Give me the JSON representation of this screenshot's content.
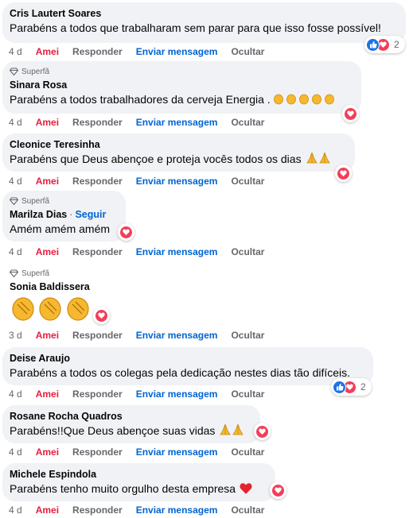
{
  "actions": {
    "amei": "Amei",
    "reply": "Responder",
    "message": "Enviar mensagem",
    "hide": "Ocultar"
  },
  "badge_label": "Superfã",
  "follow_label": "Seguir",
  "colors": {
    "love": "#f33e58",
    "like": "#1b74e4",
    "amei": "#e41e3f",
    "link": "#0064d1",
    "bubble": "#f0f2f5"
  },
  "comments": [
    {
      "name": "Cris Lautert Soares",
      "text": "Parabéns a todos que trabalharam sem parar para que isso fosse possível!",
      "time": "4 d",
      "reactions": [
        "like-icon",
        "heart-icon"
      ],
      "count": "2"
    },
    {
      "name": "Sinara Rosa",
      "superfan": true,
      "text": "Parabéns a todos trabalhadores da cerveja Energia .",
      "emoji": [
        "clap-emoji",
        "clap-emoji",
        "clap-emoji",
        "clap-emoji",
        "clap-emoji"
      ],
      "time": "4 d",
      "reactions": [
        "heart-icon"
      ]
    },
    {
      "name": "Cleonice Teresinha",
      "text": "Parabéns que Deus abençoe e proteja vocês todos os dias",
      "emoji": [
        "pray-emoji",
        "pray-emoji"
      ],
      "time": "4 d",
      "reactions": [
        "heart-icon"
      ]
    },
    {
      "name": "Marilza Dias",
      "superfan": true,
      "follow": true,
      "text": "Amém amém amém",
      "time": "4 d",
      "reactions": [
        "heart-icon"
      ]
    },
    {
      "name": "Sonia Baldissera",
      "superfan": true,
      "big_emoji": [
        "clap-emoji",
        "clap-emoji",
        "clap-emoji"
      ],
      "time": "3 d",
      "reactions": [
        "heart-icon"
      ]
    },
    {
      "name": "Deise Araujo",
      "text": "Parabéns a todos os colegas pela dedicação nestes dias tão difíceis.",
      "time": "4 d",
      "reactions": [
        "like-icon",
        "heart-icon"
      ],
      "count": "2"
    },
    {
      "name": "Rosane Rocha Quadros",
      "text": "Parabéns!!Que Deus abençoe suas vidas",
      "emoji": [
        "pray-emoji",
        "pray-emoji"
      ],
      "time": "4 d",
      "reactions": [
        "heart-icon"
      ]
    },
    {
      "name": "Michele Espindola",
      "text": "Parabéns tenho muito orgulho desta empresa",
      "emoji": [
        "red-heart-emoji"
      ],
      "time": "4 d",
      "reactions": [
        "heart-icon"
      ]
    }
  ]
}
